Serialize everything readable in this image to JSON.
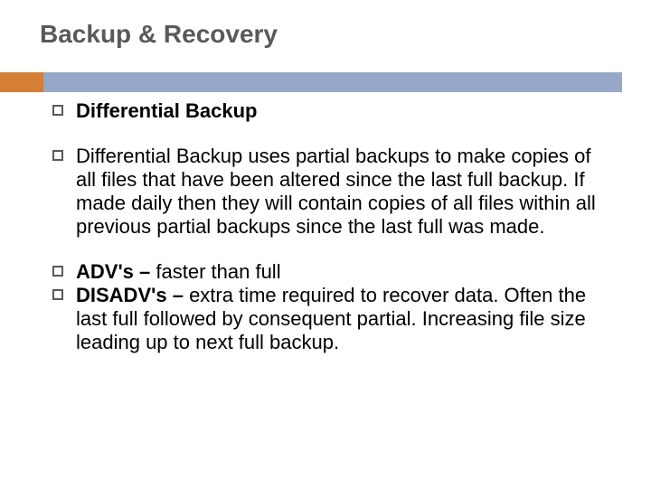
{
  "title": "Backup & Recovery",
  "items": [
    {
      "bold": "Differential Backup",
      "rest": ""
    },
    {
      "bold": "",
      "rest": "Differential Backup uses partial backups to make copies of all files that have been altered since the last full backup. If made daily then they will contain copies of all files within all previous partial backups since the last full was made."
    },
    {
      "bold": "ADV's – ",
      "rest": "faster than full"
    },
    {
      "bold": "DISADV's – ",
      "rest": "extra time required to recover data. Often the last full followed by consequent partial. Increasing file size leading up to next full backup."
    }
  ]
}
